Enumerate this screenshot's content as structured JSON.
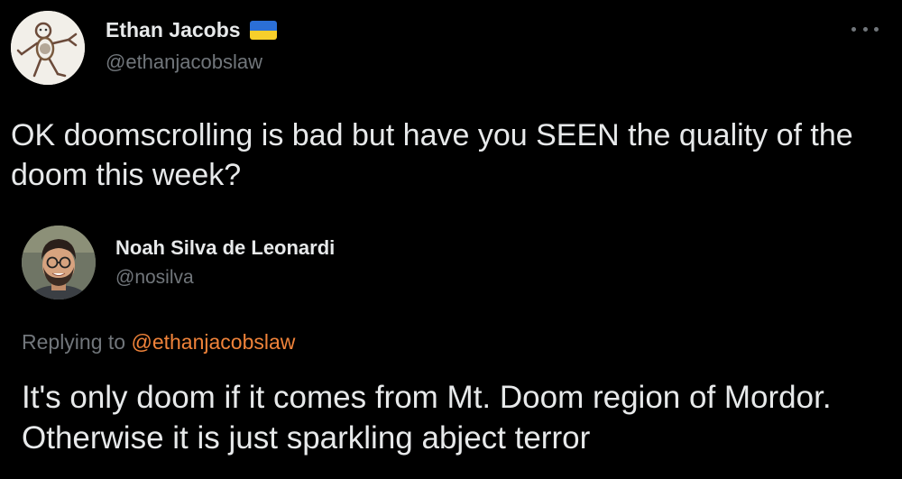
{
  "tweet": {
    "author_name": "Ethan Jacobs",
    "author_badge_icon": "ukraine-flag-icon",
    "author_handle": "@ethanjacobslaw",
    "more_icon": "more-options-icon",
    "text": "OK doomscrolling is bad but have you SEEN the quality of the doom this week?"
  },
  "reply": {
    "author_name": "Noah Silva de Leonardi",
    "author_handle": "@nosilva",
    "replying_prefix": "Replying to",
    "replying_mention": "@ethanjacobslaw",
    "text": "It's only doom if it comes from Mt. Doom region of Mordor. Otherwise it is just sparkling abject terror"
  },
  "colors": {
    "background": "#000000",
    "primary_text": "#e7e9ea",
    "secondary_text": "#71767b",
    "mention": "#f0833a",
    "flag_blue": "#2b6fd6",
    "flag_yellow": "#f7cf2b"
  }
}
